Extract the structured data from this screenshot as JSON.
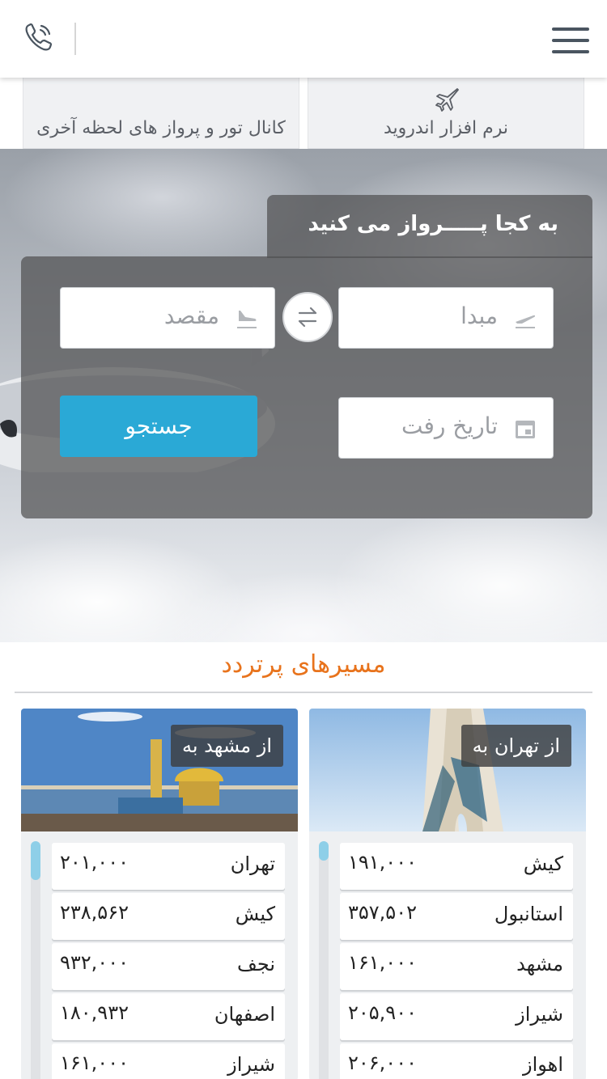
{
  "header": {
    "phone_icon": "phone-icon",
    "menu_icon": "hamburger-menu-icon"
  },
  "top_links": {
    "android_label": "نرم افزار اندروید",
    "channel_label": "کانال تور و پرواز های لحظه آخری"
  },
  "search": {
    "title": "به کجا پـــــرواز می کنید",
    "origin_placeholder": "مبدا",
    "destination_placeholder": "مقصد",
    "date_placeholder": "تاریخ رفت",
    "search_button": "جستجو"
  },
  "popular": {
    "title": "مسیرهای پرتردد",
    "cards": [
      {
        "tag": "از تهران به",
        "scroll_fraction": 0.08,
        "routes": [
          {
            "city": "کیش",
            "price": "۱۹۱,۰۰۰"
          },
          {
            "city": "استانبول",
            "price": "۳۵۷,۵۰۲"
          },
          {
            "city": "مشهد",
            "price": "۱۶۱,۰۰۰"
          },
          {
            "city": "شیراز",
            "price": "۲۰۵,۹۰۰"
          },
          {
            "city": "اهواز",
            "price": "۲۰۶,۰۰۰"
          }
        ]
      },
      {
        "tag": "از مشهد به",
        "scroll_fraction": 0.16,
        "routes": [
          {
            "city": "تهران",
            "price": "۲۰۱,۰۰۰"
          },
          {
            "city": "کیش",
            "price": "۲۳۸,۵۶۲"
          },
          {
            "city": "نجف",
            "price": "۹۳۲,۰۰۰"
          },
          {
            "city": "اصفهان",
            "price": "۱۸۰,۹۳۲"
          },
          {
            "city": "شیراز",
            "price": "۱۶۱,۰۰۰"
          }
        ]
      }
    ]
  },
  "colors": {
    "accent_orange": "#e8731c",
    "button_blue": "#2aa9d6",
    "scroll_thumb": "#8ecfe8"
  }
}
